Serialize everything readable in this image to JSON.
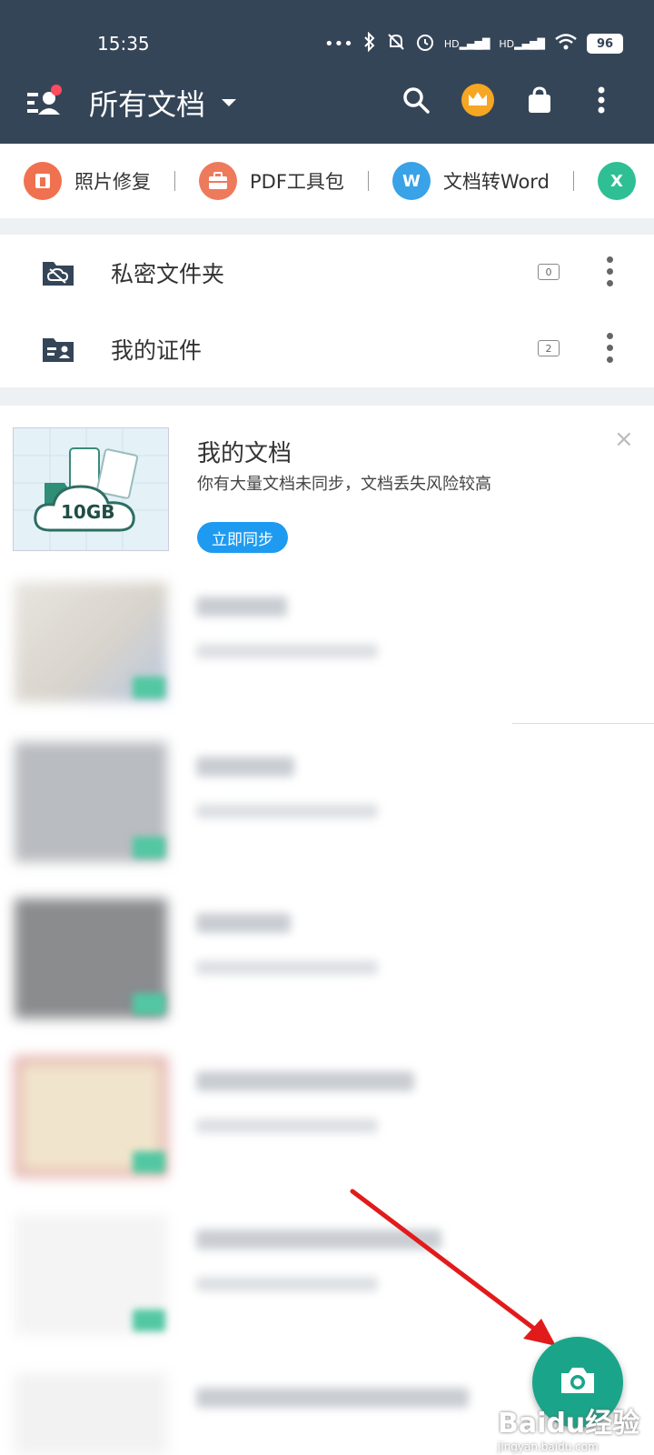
{
  "status_bar": {
    "time": "15:35",
    "battery": "96",
    "signal_label_1": "HD",
    "signal_label_2": "HD"
  },
  "toolbar": {
    "title": "所有文档"
  },
  "tools": [
    {
      "label": "照片修复",
      "color": "#f0714f",
      "icon": "photo-repair-icon"
    },
    {
      "label": "PDF工具包",
      "color": "#ee7a5c",
      "icon": "briefcase-icon"
    },
    {
      "label": "文档转Word",
      "color": "#3aa2e6",
      "icon": "word-icon",
      "glyph": "W"
    },
    {
      "label": "",
      "color": "#2fbf94",
      "icon": "excel-icon",
      "glyph": "X"
    }
  ],
  "folders": [
    {
      "name": "私密文件夹",
      "count": "0"
    },
    {
      "name": "我的证件",
      "count": "2"
    }
  ],
  "promo": {
    "title": "我的文档",
    "description": "你有大量文档未同步，文档丢失风险较高",
    "button": "立即同步",
    "storage": "10GB",
    "close": "×"
  },
  "watermark": {
    "main": "Baidu经验",
    "sub": "jingyan.baidu.com"
  }
}
